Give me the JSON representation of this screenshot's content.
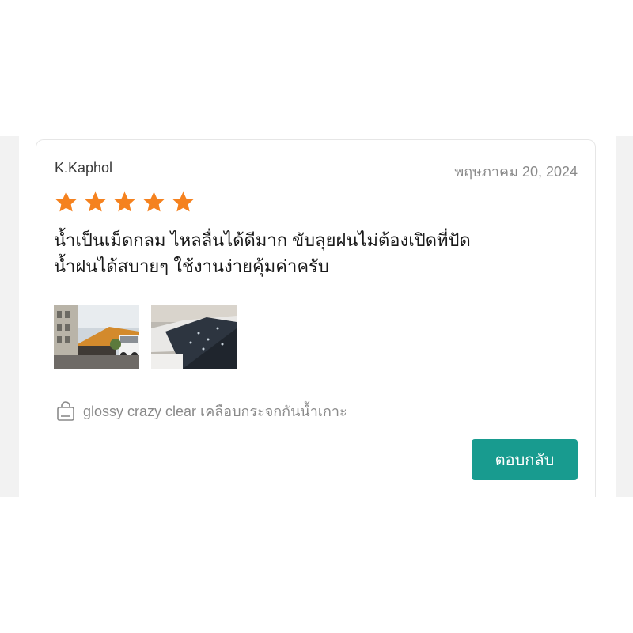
{
  "review": {
    "reviewer_name": "K.Kaphol",
    "date": "พฤษภาคม 20, 2024",
    "rating": 5,
    "rating_max": 5,
    "star_color": "#f5821f",
    "text_line1": "น้ำเป็นเม็ดกลม ไหลลื่นได้ดีมาก ขับลุยฝนไม่ต้องเปิดที่ปัด",
    "text_line2": "น้ำฝนได้สบายๆ ใช้งานง่ายคุ้มค่าครับ",
    "photos": [
      {
        "icon": "photo-thumbnail-building"
      },
      {
        "icon": "photo-thumbnail-car-windshield"
      }
    ],
    "product_icon": "shopping-bag-icon",
    "product_name": "glossy crazy clear เคลือบกระจกกันน้ำเกาะ",
    "reply_label": "ตอบกลับ",
    "accent_color": "#189b8f"
  }
}
